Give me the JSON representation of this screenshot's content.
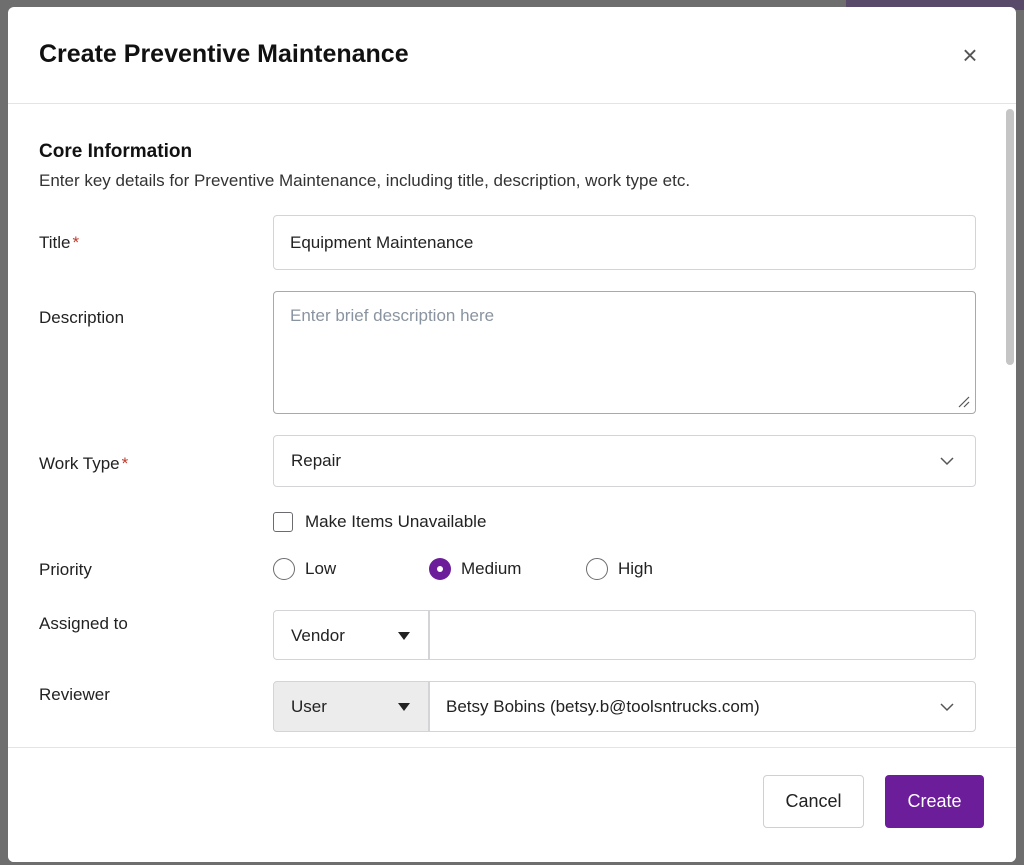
{
  "modal": {
    "title": "Create Preventive Maintenance",
    "close_label": "×"
  },
  "section": {
    "title": "Core Information",
    "description": "Enter key details for Preventive Maintenance, including title, description, work type etc."
  },
  "fields": {
    "title": {
      "label": "Title",
      "required_mark": "*",
      "value": "Equipment Maintenance"
    },
    "description": {
      "label": "Description",
      "placeholder": "Enter brief description here",
      "value": ""
    },
    "work_type": {
      "label": "Work Type",
      "required_mark": "*",
      "value": "Repair"
    },
    "make_unavailable": {
      "label": "Make Items Unavailable",
      "checked": false
    },
    "priority": {
      "label": "Priority",
      "options": [
        {
          "label": "Low",
          "checked": false
        },
        {
          "label": "Medium",
          "checked": true
        },
        {
          "label": "High",
          "checked": false
        }
      ]
    },
    "assigned_to": {
      "label": "Assigned to",
      "type_value": "Vendor",
      "value": ""
    },
    "reviewer": {
      "label": "Reviewer",
      "type_value": "User",
      "value": "Betsy Bobins (betsy.b@toolsntrucks.com)"
    }
  },
  "footer": {
    "cancel_label": "Cancel",
    "create_label": "Create"
  },
  "colors": {
    "accent": "#6c1d9a",
    "required": "#c0392b"
  },
  "icons": {
    "close": "close-icon",
    "chevron": "chevron-down-icon",
    "caret": "caret-down-icon",
    "resize": "resize-grip-icon"
  }
}
